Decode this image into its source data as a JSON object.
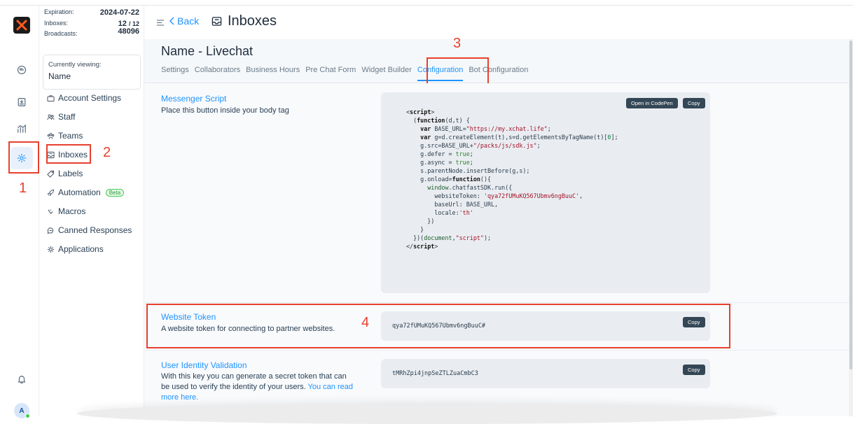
{
  "account": {
    "expiration_label": "Expiration:",
    "expiration_value": "2024-07-22",
    "inboxes_label": "Inboxes:",
    "inboxes_value": "12",
    "inboxes_total": "/ 12",
    "broadcasts_label": "Broadcasts:",
    "broadcasts_value": "48096"
  },
  "viewing": {
    "label": "Currently viewing:",
    "name": "Name"
  },
  "sidebar": {
    "items": [
      {
        "label": "Account Settings",
        "icon": "briefcase-icon"
      },
      {
        "label": "Staff",
        "icon": "people-icon"
      },
      {
        "label": "Teams",
        "icon": "teams-icon"
      },
      {
        "label": "Inboxes",
        "icon": "inbox-icon"
      },
      {
        "label": "Labels",
        "icon": "tag-icon"
      },
      {
        "label": "Automation",
        "icon": "rocket-icon",
        "badge": "Beta"
      },
      {
        "label": "Macros",
        "icon": "macros-icon"
      },
      {
        "label": "Canned Responses",
        "icon": "chat-bubbles-icon"
      },
      {
        "label": "Applications",
        "icon": "apps-icon"
      }
    ]
  },
  "rail": {
    "avatar_letter": "A"
  },
  "header": {
    "back_label": "Back",
    "title": "Inboxes"
  },
  "page": {
    "title": "Name - Livechat",
    "tabs": [
      "Settings",
      "Collaborators",
      "Business Hours",
      "Pre Chat Form",
      "Widget Builder",
      "Configuration",
      "Bot Configuration"
    ],
    "active_tab": "Configuration"
  },
  "messenger": {
    "title": "Messenger Script",
    "desc": "Place this button inside your body tag",
    "open_codepen": "Open in CodePen",
    "copy": "Copy"
  },
  "website_token": {
    "title": "Website Token",
    "desc": "A website token for connecting to partner websites.",
    "value": "qya72fUMuKQ567Ubmv6ngBuuC#",
    "copy": "Copy"
  },
  "identity": {
    "title": "User Identity Validation",
    "desc": "With this key you can generate a secret token that can be used to verify the identity of your users.",
    "link": "You can read more here.",
    "value": "tMRhZpi4jnpSeZTLZuaCmbC3",
    "copy": "Copy"
  },
  "annotations": [
    "1",
    "2",
    "3",
    "4"
  ],
  "colors": {
    "accent": "#1f93ff",
    "annotation": "#e8402f",
    "button": "#344756"
  }
}
